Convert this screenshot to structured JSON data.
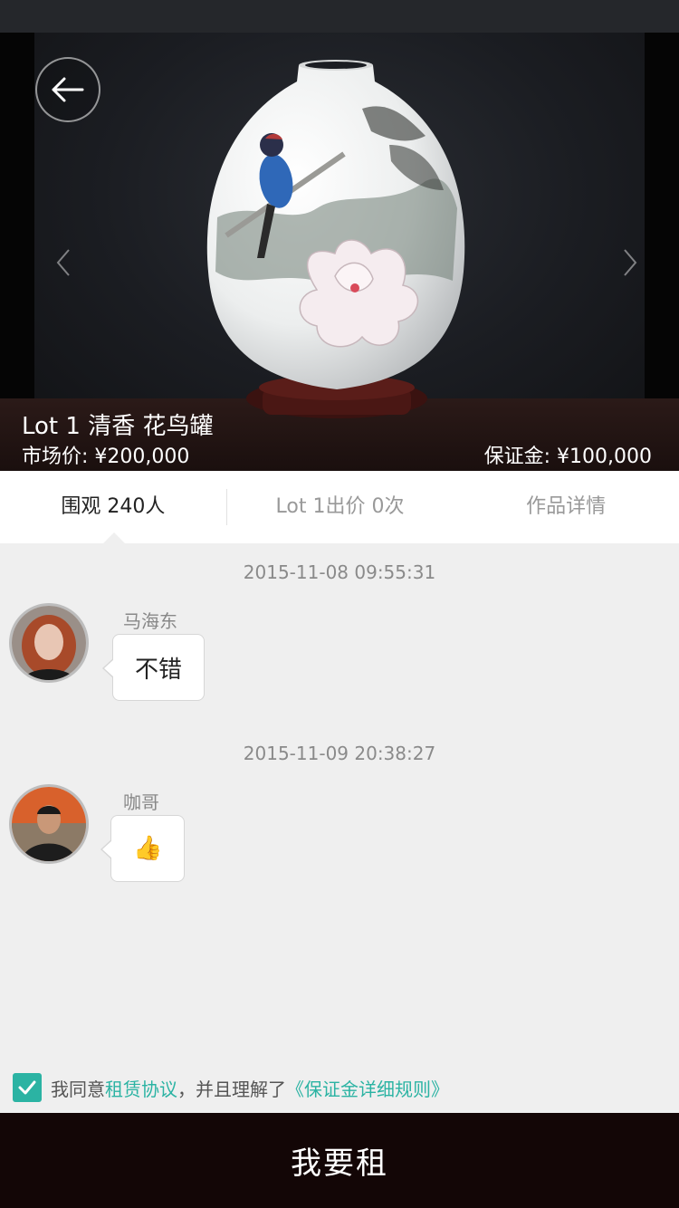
{
  "hero": {
    "lot_title": "Lot 1 清香 花鸟罐",
    "market_price": "市场价: ¥200,000",
    "deposit": "保证金: ¥100,000"
  },
  "tabs": [
    {
      "label": "围观 240人",
      "active": true
    },
    {
      "label": "Lot 1出价 0次",
      "active": false
    },
    {
      "label": "作品详情",
      "active": false
    }
  ],
  "messages": [
    {
      "timestamp": "2015-11-08 09:55:31",
      "sender": "马海东",
      "text": "不错"
    },
    {
      "timestamp": "2015-11-09 20:38:27",
      "sender": "咖哥",
      "text": "👍"
    }
  ],
  "agreement": {
    "checked": true,
    "prefix": "我同意",
    "link1": "租赁协议",
    "middle": "，并且理解了",
    "link2": "《保证金详细规则》"
  },
  "action": {
    "label": "我要租"
  },
  "colors": {
    "accent": "#2bb3a3",
    "bottom_bar": "#130606",
    "background": "#efefef"
  }
}
